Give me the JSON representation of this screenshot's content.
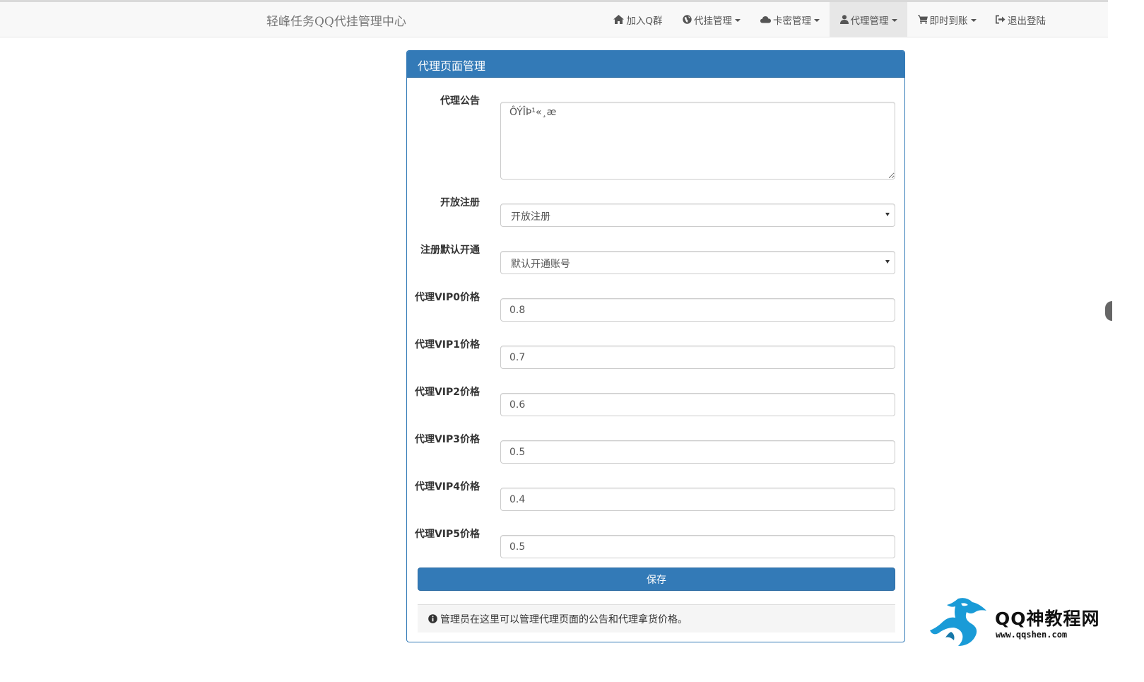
{
  "navbar": {
    "brand": "轻峰任务QQ代挂管理中心",
    "items": [
      {
        "label": "加入Q群",
        "icon": "home-icon",
        "dropdown": false,
        "active": false
      },
      {
        "label": "代挂管理",
        "icon": "globe-icon",
        "dropdown": true,
        "active": false
      },
      {
        "label": "卡密管理",
        "icon": "cloud-icon",
        "dropdown": true,
        "active": false
      },
      {
        "label": "代理管理",
        "icon": "user-icon",
        "dropdown": true,
        "active": true
      },
      {
        "label": "即时到账",
        "icon": "cart-icon",
        "dropdown": true,
        "active": false
      },
      {
        "label": "退出登陆",
        "icon": "logout-icon",
        "dropdown": false,
        "active": false
      }
    ]
  },
  "panel": {
    "title": "代理页面管理",
    "fields": {
      "notice": {
        "label": "代理公告",
        "value": "ÔÝÎÞ¹«¸æ"
      },
      "open_register": {
        "label": "开放注册",
        "value": "开放注册"
      },
      "default_open": {
        "label": "注册默认开通",
        "value": "默认开通账号"
      },
      "vip0": {
        "label": "代理VIP0价格",
        "value": "0.8"
      },
      "vip1": {
        "label": "代理VIP1价格",
        "value": "0.7"
      },
      "vip2": {
        "label": "代理VIP2价格",
        "value": "0.6"
      },
      "vip3": {
        "label": "代理VIP3价格",
        "value": "0.5"
      },
      "vip4": {
        "label": "代理VIP4价格",
        "value": "0.4"
      },
      "vip5": {
        "label": "代理VIP5价格",
        "value": "0.5"
      }
    },
    "save_label": "保存",
    "info_text": "管理员在这里可以管理代理页面的公告和代理拿货价格。"
  },
  "watermark": {
    "title": "QQ神教程网",
    "url": "www.qqshen.com"
  },
  "colors": {
    "primary": "#337ab7",
    "navbar_bg": "#f8f8f8",
    "nav_active_bg": "#e7e7e7",
    "info_bg": "#f5f5f5",
    "watermark_dragon": "#1a9bd7"
  }
}
